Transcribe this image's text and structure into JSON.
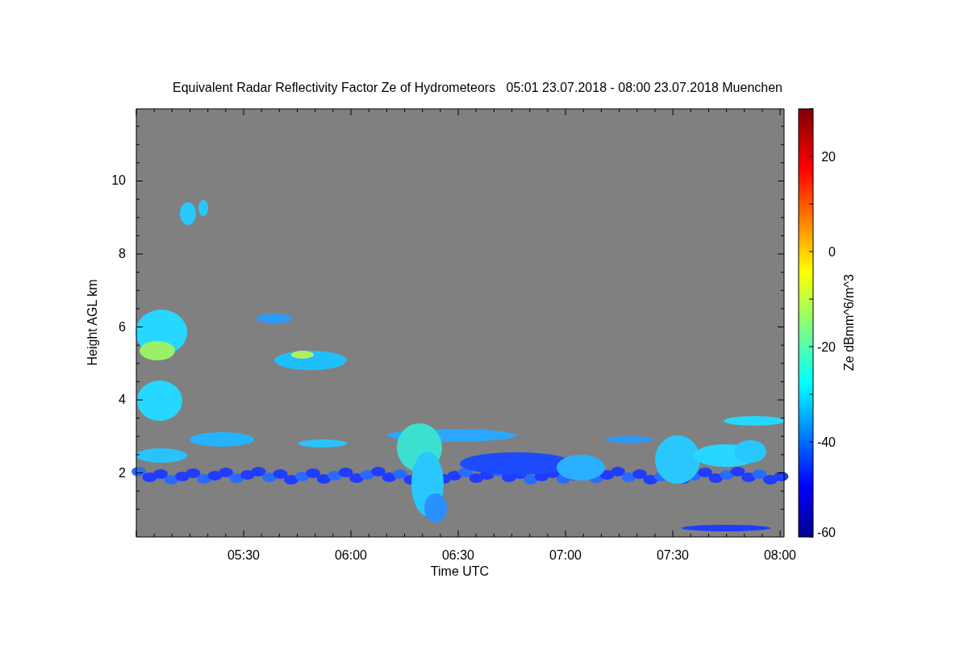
{
  "plot": {
    "title": "Equivalent Radar Reflectivity Factor Ze of Hydrometeors   05:01 23.07.2018 - 08:00 23.07.2018 Muenchen",
    "xlabel": "Time UTC",
    "ylabel": "Height AGL km",
    "xtick_labels": [
      "05:30",
      "06:00",
      "06:30",
      "07:00",
      "07:30",
      "08:00"
    ],
    "ytick_labels": [
      "10",
      "8",
      "6",
      "4",
      "2"
    ]
  },
  "colorbar": {
    "label": "Ze dBmm^6/m^3",
    "tick_labels": [
      "20",
      "0",
      "-20",
      "-40",
      "-60"
    ]
  }
}
